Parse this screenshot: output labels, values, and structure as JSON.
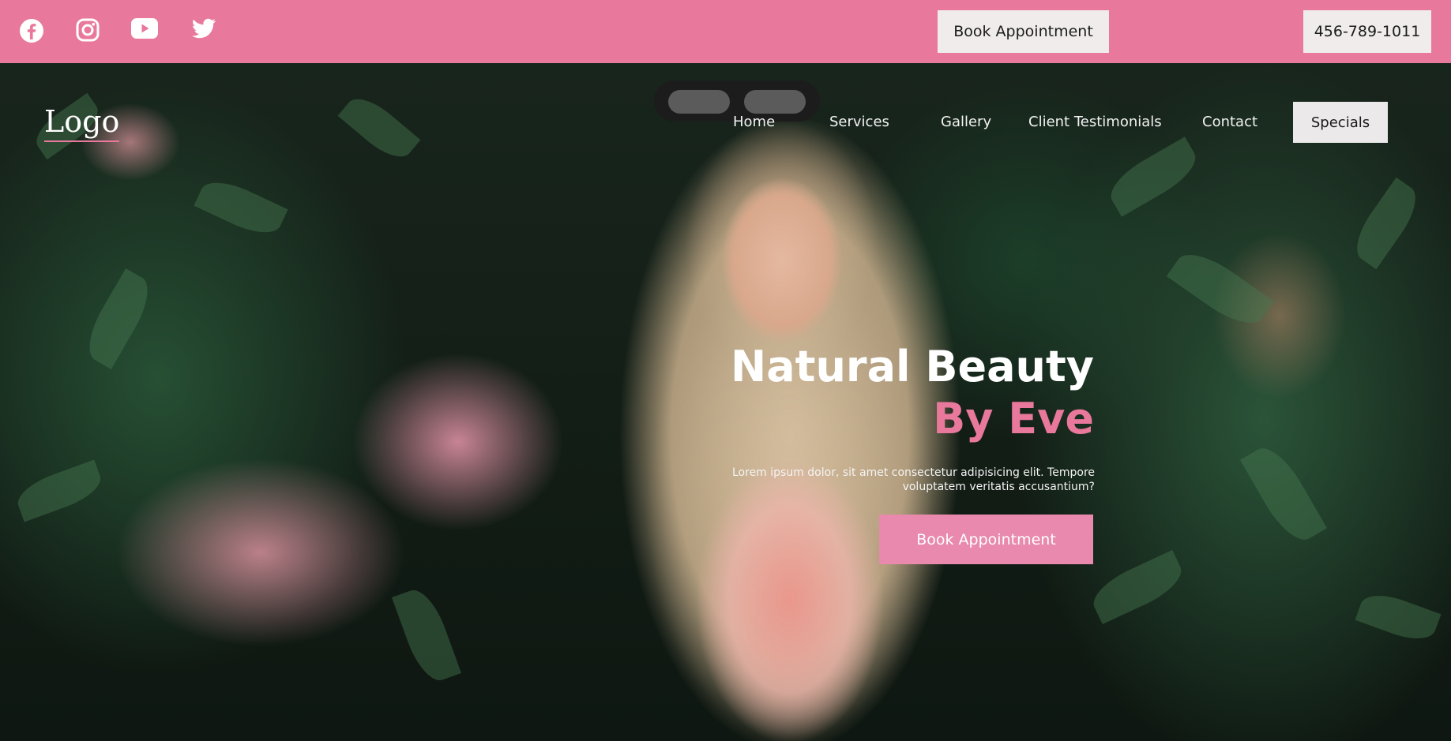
{
  "topbar": {
    "social": [
      {
        "icon": "facebook-icon"
      },
      {
        "icon": "instagram-icon"
      },
      {
        "icon": "youtube-icon"
      },
      {
        "icon": "twitter-icon"
      }
    ],
    "book_label": "Book Appointment",
    "phone": "456-789-1011"
  },
  "header": {
    "logo": "Logo",
    "nav": [
      "Home",
      "Services",
      "Gallery",
      "Client Testimonials",
      "Contact"
    ],
    "specials_label": "Specials"
  },
  "hero": {
    "title": "Natural Beauty",
    "title_accent": "By Eve",
    "description": "Lorem ipsum dolor, sit amet consectetur adipisicing elit. Tempore voluptatem veritatis accusantium?",
    "cta_label": "Book Appointment"
  },
  "colors": {
    "brand_pink": "#e8789c",
    "button_pink": "#e889ad",
    "light_button": "#f0ecec"
  }
}
